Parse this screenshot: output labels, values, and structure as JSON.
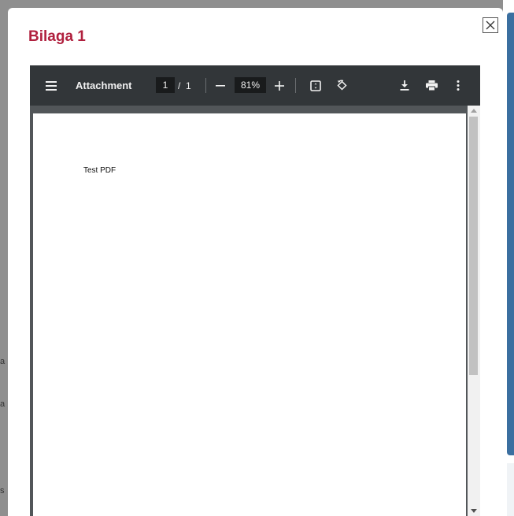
{
  "modal": {
    "title": "Bilaga 1",
    "close_icon": "close-icon"
  },
  "pdf_viewer": {
    "document_title": "Attachment",
    "current_page": "1",
    "page_separator": "/",
    "total_pages": "1",
    "zoom": "81%",
    "icons": [
      "menu-icon",
      "zoom-out-icon",
      "zoom-in-icon",
      "fit-page-icon",
      "rotate-icon",
      "download-icon",
      "print-icon",
      "more-options-icon"
    ],
    "page_text": "Test PDF"
  },
  "backdrop": {
    "fragments": [
      "a",
      "a",
      "s"
    ]
  },
  "colors": {
    "title": "#b0203e",
    "toolbar": "#323639",
    "viewer_bg": "#525659",
    "side_bar": "#3b6fa0"
  }
}
